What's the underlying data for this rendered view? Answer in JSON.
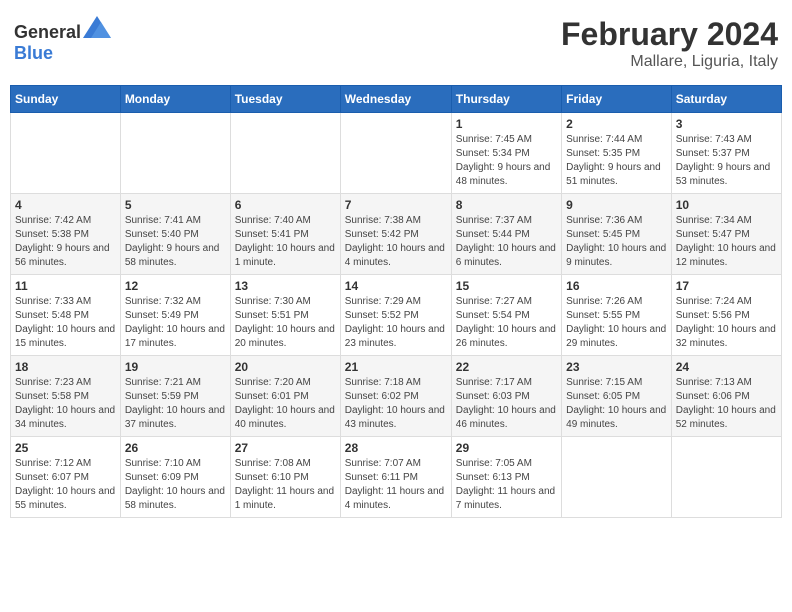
{
  "header": {
    "logo_general": "General",
    "logo_blue": "Blue",
    "month_title": "February 2024",
    "location": "Mallare, Liguria, Italy"
  },
  "weekdays": [
    "Sunday",
    "Monday",
    "Tuesday",
    "Wednesday",
    "Thursday",
    "Friday",
    "Saturday"
  ],
  "weeks": [
    [
      {
        "day": "",
        "info": ""
      },
      {
        "day": "",
        "info": ""
      },
      {
        "day": "",
        "info": ""
      },
      {
        "day": "",
        "info": ""
      },
      {
        "day": "1",
        "info": "Sunrise: 7:45 AM\nSunset: 5:34 PM\nDaylight: 9 hours and 48 minutes."
      },
      {
        "day": "2",
        "info": "Sunrise: 7:44 AM\nSunset: 5:35 PM\nDaylight: 9 hours and 51 minutes."
      },
      {
        "day": "3",
        "info": "Sunrise: 7:43 AM\nSunset: 5:37 PM\nDaylight: 9 hours and 53 minutes."
      }
    ],
    [
      {
        "day": "4",
        "info": "Sunrise: 7:42 AM\nSunset: 5:38 PM\nDaylight: 9 hours and 56 minutes."
      },
      {
        "day": "5",
        "info": "Sunrise: 7:41 AM\nSunset: 5:40 PM\nDaylight: 9 hours and 58 minutes."
      },
      {
        "day": "6",
        "info": "Sunrise: 7:40 AM\nSunset: 5:41 PM\nDaylight: 10 hours and 1 minute."
      },
      {
        "day": "7",
        "info": "Sunrise: 7:38 AM\nSunset: 5:42 PM\nDaylight: 10 hours and 4 minutes."
      },
      {
        "day": "8",
        "info": "Sunrise: 7:37 AM\nSunset: 5:44 PM\nDaylight: 10 hours and 6 minutes."
      },
      {
        "day": "9",
        "info": "Sunrise: 7:36 AM\nSunset: 5:45 PM\nDaylight: 10 hours and 9 minutes."
      },
      {
        "day": "10",
        "info": "Sunrise: 7:34 AM\nSunset: 5:47 PM\nDaylight: 10 hours and 12 minutes."
      }
    ],
    [
      {
        "day": "11",
        "info": "Sunrise: 7:33 AM\nSunset: 5:48 PM\nDaylight: 10 hours and 15 minutes."
      },
      {
        "day": "12",
        "info": "Sunrise: 7:32 AM\nSunset: 5:49 PM\nDaylight: 10 hours and 17 minutes."
      },
      {
        "day": "13",
        "info": "Sunrise: 7:30 AM\nSunset: 5:51 PM\nDaylight: 10 hours and 20 minutes."
      },
      {
        "day": "14",
        "info": "Sunrise: 7:29 AM\nSunset: 5:52 PM\nDaylight: 10 hours and 23 minutes."
      },
      {
        "day": "15",
        "info": "Sunrise: 7:27 AM\nSunset: 5:54 PM\nDaylight: 10 hours and 26 minutes."
      },
      {
        "day": "16",
        "info": "Sunrise: 7:26 AM\nSunset: 5:55 PM\nDaylight: 10 hours and 29 minutes."
      },
      {
        "day": "17",
        "info": "Sunrise: 7:24 AM\nSunset: 5:56 PM\nDaylight: 10 hours and 32 minutes."
      }
    ],
    [
      {
        "day": "18",
        "info": "Sunrise: 7:23 AM\nSunset: 5:58 PM\nDaylight: 10 hours and 34 minutes."
      },
      {
        "day": "19",
        "info": "Sunrise: 7:21 AM\nSunset: 5:59 PM\nDaylight: 10 hours and 37 minutes."
      },
      {
        "day": "20",
        "info": "Sunrise: 7:20 AM\nSunset: 6:01 PM\nDaylight: 10 hours and 40 minutes."
      },
      {
        "day": "21",
        "info": "Sunrise: 7:18 AM\nSunset: 6:02 PM\nDaylight: 10 hours and 43 minutes."
      },
      {
        "day": "22",
        "info": "Sunrise: 7:17 AM\nSunset: 6:03 PM\nDaylight: 10 hours and 46 minutes."
      },
      {
        "day": "23",
        "info": "Sunrise: 7:15 AM\nSunset: 6:05 PM\nDaylight: 10 hours and 49 minutes."
      },
      {
        "day": "24",
        "info": "Sunrise: 7:13 AM\nSunset: 6:06 PM\nDaylight: 10 hours and 52 minutes."
      }
    ],
    [
      {
        "day": "25",
        "info": "Sunrise: 7:12 AM\nSunset: 6:07 PM\nDaylight: 10 hours and 55 minutes."
      },
      {
        "day": "26",
        "info": "Sunrise: 7:10 AM\nSunset: 6:09 PM\nDaylight: 10 hours and 58 minutes."
      },
      {
        "day": "27",
        "info": "Sunrise: 7:08 AM\nSunset: 6:10 PM\nDaylight: 11 hours and 1 minute."
      },
      {
        "day": "28",
        "info": "Sunrise: 7:07 AM\nSunset: 6:11 PM\nDaylight: 11 hours and 4 minutes."
      },
      {
        "day": "29",
        "info": "Sunrise: 7:05 AM\nSunset: 6:13 PM\nDaylight: 11 hours and 7 minutes."
      },
      {
        "day": "",
        "info": ""
      },
      {
        "day": "",
        "info": ""
      }
    ]
  ]
}
